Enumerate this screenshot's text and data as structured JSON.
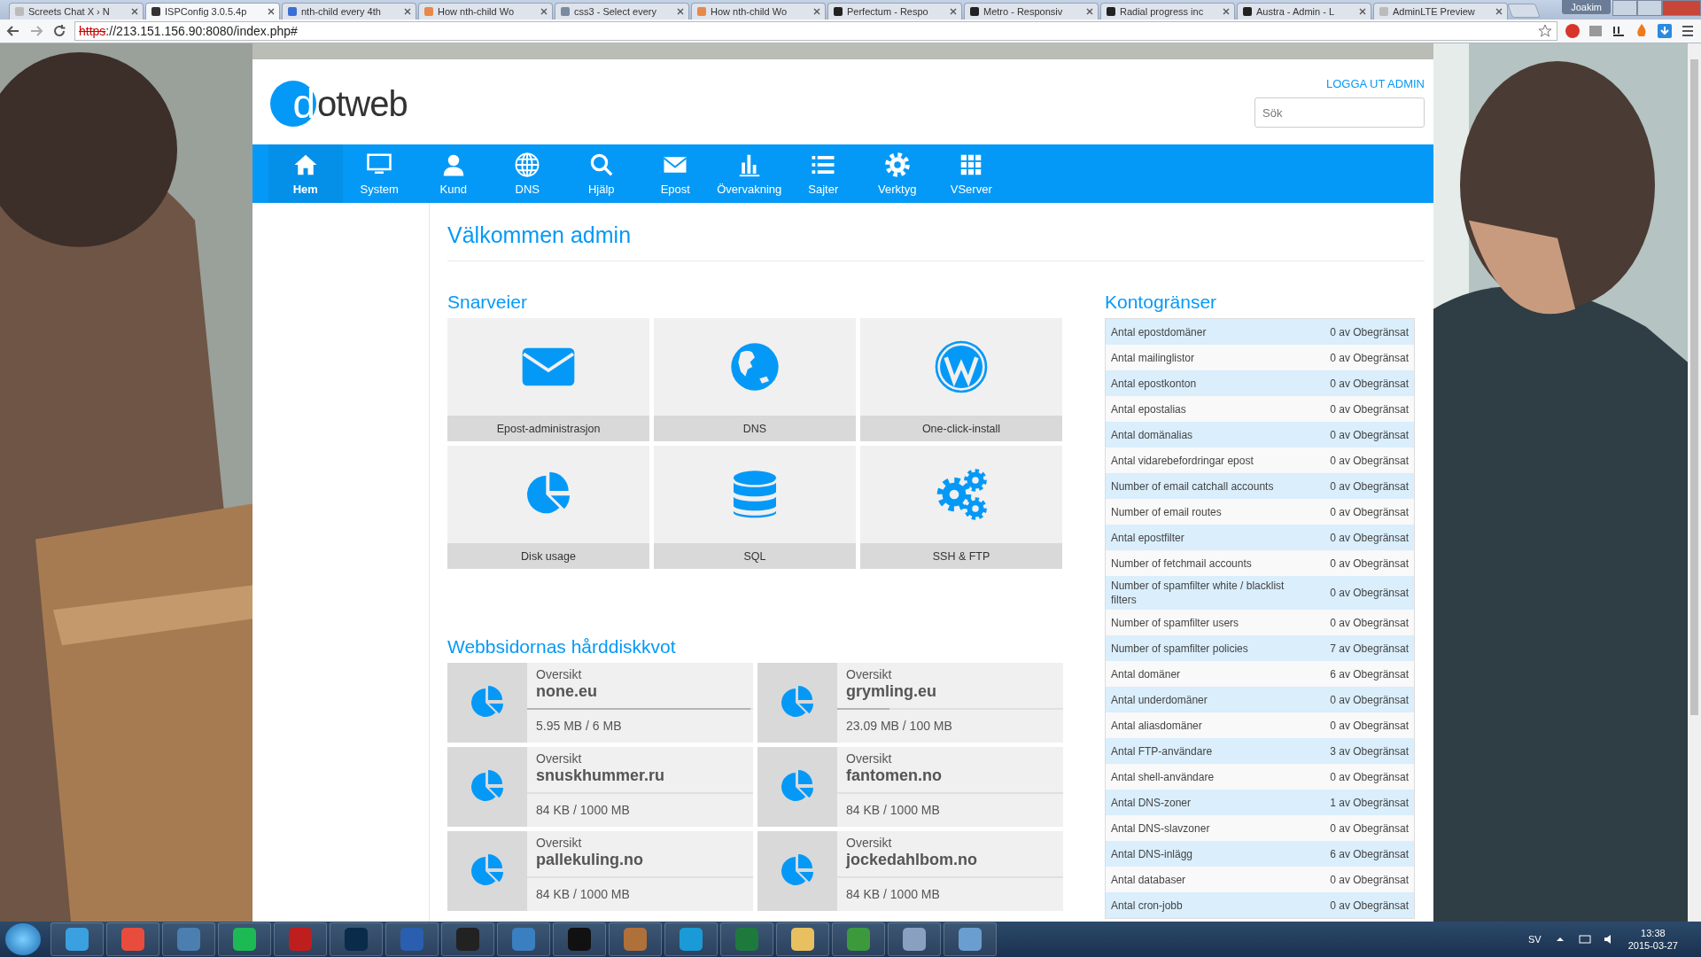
{
  "browser": {
    "tabs": [
      {
        "title": "Screets Chat X › N",
        "selected": false
      },
      {
        "title": "ISPConfig 3.0.5.4p",
        "selected": true
      },
      {
        "title": "nth-child every 4th",
        "selected": false
      },
      {
        "title": "How nth-child Wo",
        "selected": false
      },
      {
        "title": "css3 - Select every",
        "selected": false
      },
      {
        "title": "How nth-child Wo",
        "selected": false
      },
      {
        "title": "Perfectum - Respo",
        "selected": false
      },
      {
        "title": "Metro - Responsiv",
        "selected": false
      },
      {
        "title": "Radial progress inc",
        "selected": false
      },
      {
        "title": "Austra - Admin - L",
        "selected": false
      },
      {
        "title": "AdminLTE Preview",
        "selected": false
      }
    ],
    "user": "Joakim",
    "url_scheme": "https",
    "url_rest": "://213.151.156.90:8080/index.php#"
  },
  "header": {
    "logo_mark": "d",
    "logo_text": "otweb",
    "logout": "LOGGA UT ADMIN",
    "search": {
      "placeholder": "Sök"
    }
  },
  "nav": [
    {
      "label": "Hem",
      "selected": true
    },
    {
      "label": "System",
      "selected": false
    },
    {
      "label": "Kund",
      "selected": false
    },
    {
      "label": "DNS",
      "selected": false
    },
    {
      "label": "Hjälp",
      "selected": false
    },
    {
      "label": "Epost",
      "selected": false
    },
    {
      "label": "Övervakning",
      "selected": false
    },
    {
      "label": "Sajter",
      "selected": false
    },
    {
      "label": "Verktyg",
      "selected": false
    },
    {
      "label": "VServer",
      "selected": false
    }
  ],
  "welcome": "Välkommen admin",
  "shortcuts": {
    "title": "Snarveier",
    "items": [
      {
        "label": "Epost-administrasjon"
      },
      {
        "label": "DNS"
      },
      {
        "label": "One-click-install"
      },
      {
        "label": "Disk usage"
      },
      {
        "label": "SQL"
      },
      {
        "label": "SSH & FTP"
      }
    ]
  },
  "quota": {
    "title": "Webbsidornas hårddiskkvot",
    "items": [
      {
        "caption": "Oversikt",
        "domain": "none.eu",
        "usage": "5.95 MB / 6 MB",
        "level": 0.99
      },
      {
        "caption": "Oversikt",
        "domain": "grymling.eu",
        "usage": "23.09 MB / 100 MB",
        "level": 0.23
      },
      {
        "caption": "Oversikt",
        "domain": "snuskhummer.ru",
        "usage": "84 KB / 1000 MB",
        "level": 0
      },
      {
        "caption": "Oversikt",
        "domain": "fantomen.no",
        "usage": "84 KB / 1000 MB",
        "level": 0
      },
      {
        "caption": "Oversikt",
        "domain": "pallekuling.no",
        "usage": "84 KB / 1000 MB",
        "level": 0
      },
      {
        "caption": "Oversikt",
        "domain": "jockedahlbom.no",
        "usage": "84 KB / 1000 MB",
        "level": 0
      }
    ]
  },
  "limits": {
    "title": "Kontogränser",
    "rows": [
      {
        "name": "Antal epostdomäner",
        "value": "0 av Obegränsat"
      },
      {
        "name": "Antal mailinglistor",
        "value": "0 av Obegränsat"
      },
      {
        "name": "Antal epostkonton",
        "value": "0 av Obegränsat"
      },
      {
        "name": "Antal epostalias",
        "value": "0 av Obegränsat"
      },
      {
        "name": "Antal domänalias",
        "value": "0 av Obegränsat"
      },
      {
        "name": "Antal vidarebefordringar epost",
        "value": "0 av Obegränsat"
      },
      {
        "name": "Number of email catchall accounts",
        "value": "0 av Obegränsat"
      },
      {
        "name": "Number of email routes",
        "value": "0 av Obegränsat"
      },
      {
        "name": "Antal epostfilter",
        "value": "0 av Obegränsat"
      },
      {
        "name": "Number of fetchmail accounts",
        "value": "0 av Obegränsat"
      },
      {
        "name": "Number of spamfilter white / blacklist filters",
        "value": "0 av Obegränsat"
      },
      {
        "name": "Number of spamfilter users",
        "value": "0 av Obegränsat"
      },
      {
        "name": "Number of spamfilter policies",
        "value": "7 av Obegränsat"
      },
      {
        "name": "Antal domäner",
        "value": "6 av Obegränsat"
      },
      {
        "name": "Antal underdomäner",
        "value": "0 av Obegränsat"
      },
      {
        "name": "Antal aliasdomäner",
        "value": "0 av Obegränsat"
      },
      {
        "name": "Antal FTP-användare",
        "value": "3 av Obegränsat"
      },
      {
        "name": "Antal shell-användare",
        "value": "0 av Obegränsat"
      },
      {
        "name": "Antal DNS-zoner",
        "value": "1 av Obegränsat"
      },
      {
        "name": "Antal DNS-slavzoner",
        "value": "0 av Obegränsat"
      },
      {
        "name": "Antal DNS-inlägg",
        "value": "6 av Obegränsat"
      },
      {
        "name": "Antal databaser",
        "value": "0 av Obegränsat"
      },
      {
        "name": "Antal cron-jobb",
        "value": "0 av Obegränsat"
      }
    ]
  },
  "taskbar": {
    "language": "SV",
    "time": "13:38",
    "date": "2015-03-27"
  }
}
